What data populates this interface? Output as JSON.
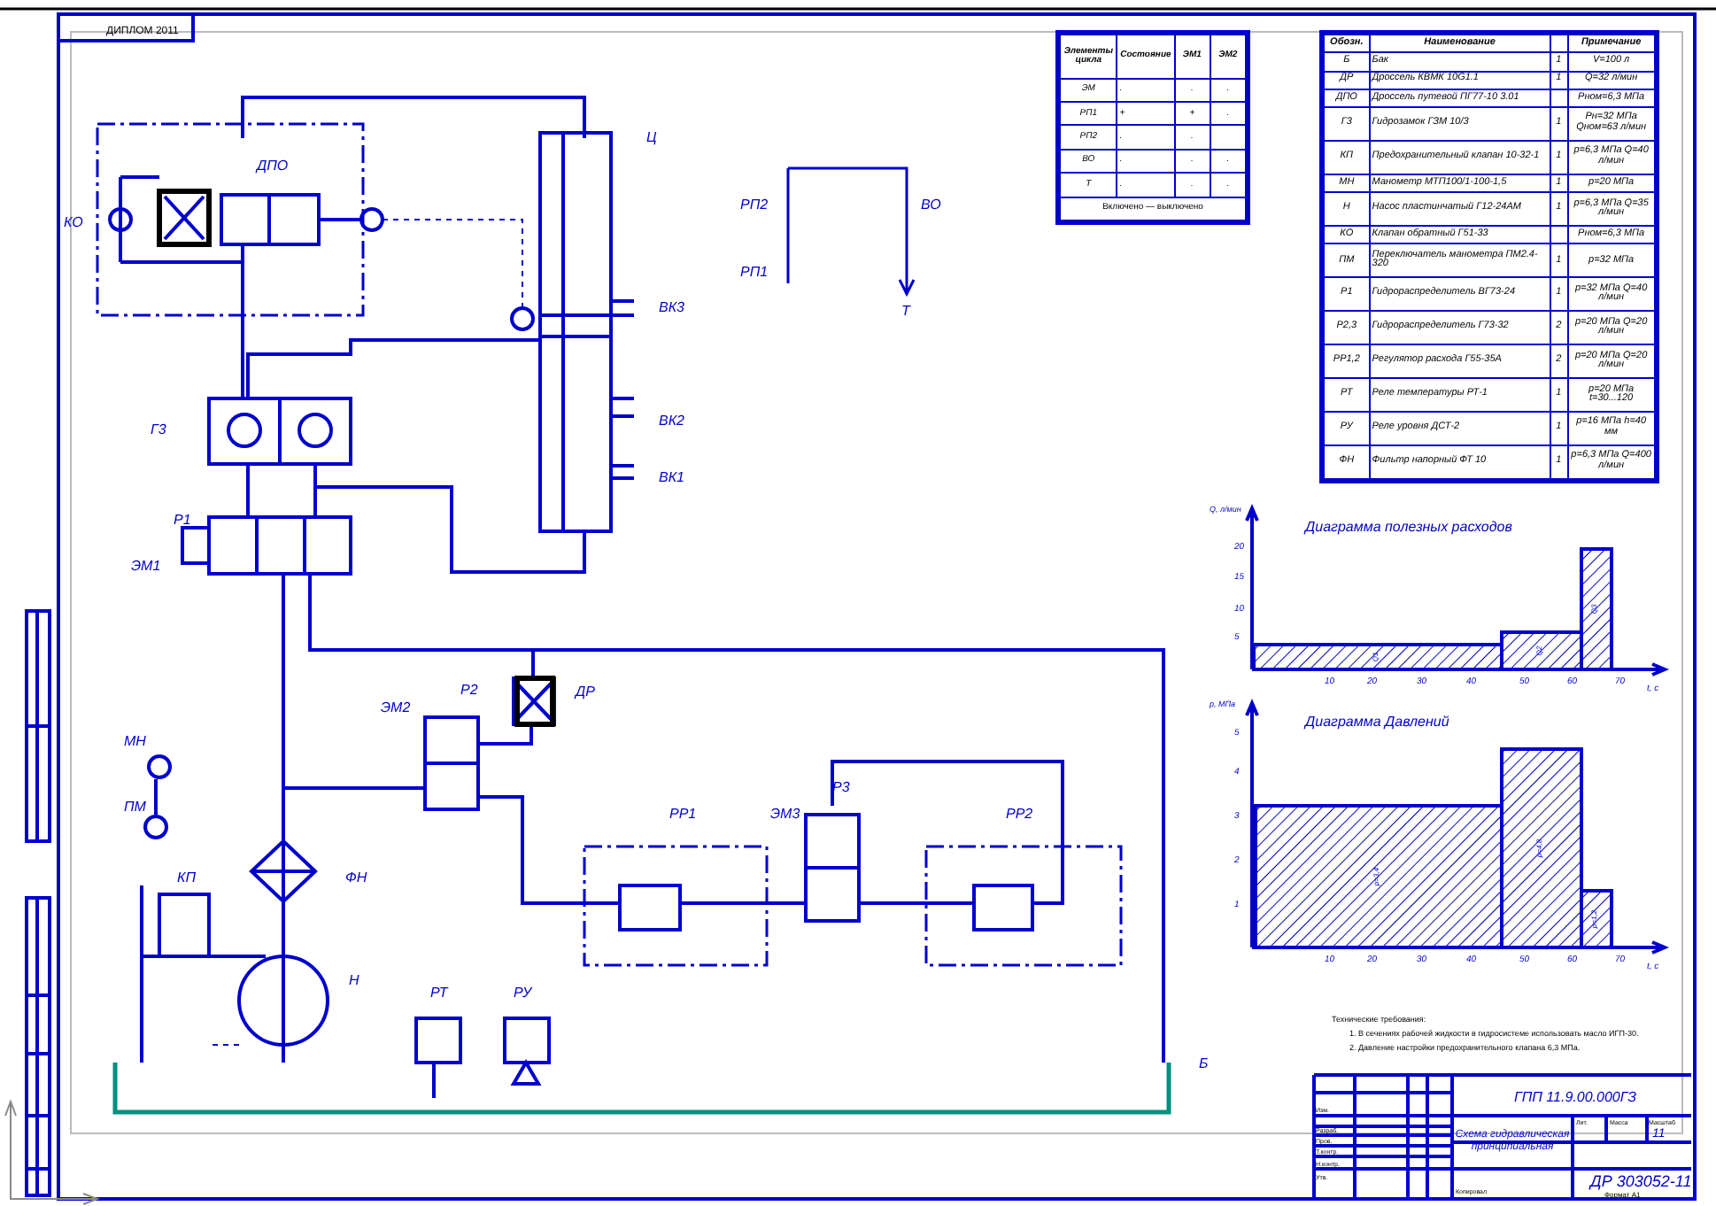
{
  "stamp": "ДИПЛОМ 2011",
  "cyclogram_table": {
    "columns": [
      "Элементы цикла",
      "Состояние",
      "ЭМ1",
      "ЭМ2"
    ],
    "rows": [
      {
        "cells": [
          "ЭМ",
          ".",
          ".",
          "."
        ]
      },
      {
        "cells": [
          "РП1",
          "+",
          "+",
          "."
        ]
      },
      {
        "cells": [
          "РП2",
          ".",
          ".",
          ""
        ]
      },
      {
        "cells": [
          "ВО",
          ".",
          ".",
          "."
        ]
      },
      {
        "cells": [
          "Т",
          ".",
          ".",
          "."
        ]
      }
    ],
    "footer": "Включено — выключено"
  },
  "parts_table": {
    "columns": [
      "Обозн.",
      "Наименование",
      "",
      "Примечание"
    ],
    "rows": [
      {
        "cells": [
          "Б",
          "Бак",
          "1",
          "V=100 л"
        ]
      },
      {
        "cells": [
          "ДР",
          "Дроссель КВМК 10G1.1",
          "1",
          "Q=32 л/мин"
        ]
      },
      {
        "cells": [
          "ДПО",
          "Дроссель путевой ПГ77-10 3.01",
          "",
          "Рном=6,3 МПа"
        ]
      },
      {
        "cells": [
          "Г3",
          "Гидрозамок ГЗМ 10/3",
          "1",
          "Рн=32 МПа Qном=63 л/мин"
        ]
      },
      {
        "cells": [
          "КП",
          "Предохранительный клапан 10-32-1",
          "1",
          "р=6,3 МПа Q=40 л/мин"
        ]
      },
      {
        "cells": [
          "МН",
          "Манометр МТП100/1-100-1,5",
          "1",
          "р=20 МПа"
        ]
      },
      {
        "cells": [
          "Н",
          "Насос пластинчатый Г12-24АМ",
          "1",
          "р=6,3 МПа Q=35 л/мин"
        ]
      },
      {
        "cells": [
          "КО",
          "Клапан обратный Г51-33",
          "",
          "Рном=6,3 МПа"
        ]
      },
      {
        "cells": [
          "ПМ",
          "Переключатель манометра ПМ2.4-320",
          "1",
          "р=32 МПа"
        ]
      },
      {
        "cells": [
          "Р1",
          "Гидрораспределитель ВГ73-24",
          "1",
          "р=32 МПа Q=40 л/мин"
        ]
      },
      {
        "cells": [
          "Р2,3",
          "Гидрораспределитель Г73-32",
          "2",
          "р=20 МПа Q=20 л/мин"
        ]
      },
      {
        "cells": [
          "РР1,2",
          "Регулятор расхода Г55-35А",
          "2",
          "р=20 МПа Q=20 л/мин"
        ]
      },
      {
        "cells": [
          "РТ",
          "Реле температуры РТ-1",
          "1",
          "р=20 МПа t=30...120"
        ]
      },
      {
        "cells": [
          "РУ",
          "Реле уровня ДСТ-2",
          "1",
          "р=16 МПа h=40 мм"
        ]
      },
      {
        "cells": [
          "ФН",
          "Фильтр напорный ФТ 10",
          "1",
          "р=6,3 МПа Q=400 л/мин"
        ]
      }
    ]
  },
  "schematic": {
    "labels": [
      "КО",
      "ДПО",
      "Ц",
      "ВК3",
      "ВК2",
      "ВК1",
      "Г3",
      "Р1",
      "ЭМ1",
      "ЭМ2",
      "Р2",
      "ДР",
      "МН",
      "ПМ",
      "КП",
      "ФН",
      "Н",
      "РТ",
      "РУ",
      "РР1",
      "ЭМ3",
      "Р3",
      "РР2",
      "Б"
    ]
  },
  "cyclogram_diagram": {
    "labels": [
      "РП2",
      "РП1",
      "ВО",
      "Т"
    ]
  },
  "flow_chart": {
    "title": "Диаграмма полезных расходов",
    "ylabel": "Q, л/мин",
    "xlabel": "t, с",
    "xticks": [
      "10",
      "20",
      "30",
      "40",
      "50",
      "60",
      "70"
    ],
    "yticks": [
      "20",
      "15",
      "10",
      "5"
    ],
    "bar_labels": [
      "Q1",
      "Q2",
      "Q3"
    ]
  },
  "pressure_chart": {
    "title": "Диаграмма Давлений",
    "ylabel": "р, МПа",
    "xlabel": "t, с",
    "xticks": [
      "10",
      "20",
      "30",
      "40",
      "50",
      "60",
      "70"
    ],
    "yticks": [
      "5",
      "4",
      "3",
      "2",
      "1"
    ],
    "bar_labels": [
      "р=3,4",
      "р=4,8",
      "р=1,2"
    ]
  },
  "notes": [
    "Технические требования:",
    "1. В сечениях рабочей жидкости в гидросистеме использовать масло ИГП-30.",
    "2. Давление настройки предохранительного клапана 6,3 МПа."
  ],
  "title_block": {
    "designation": "ГПП 11.9.00.000ГЗ",
    "title": "Схема гидравлическая принципиальная",
    "sheet": "11",
    "code": "ДР 303052-11",
    "headers": [
      "Лит.",
      "Масса",
      "Масштаб"
    ],
    "roles": [
      "Изм.",
      "Разраб.",
      "Пров.",
      "Т.контр.",
      "Н.контр.",
      "Утв."
    ],
    "copied": "Копировал",
    "format": "Формат A1"
  }
}
